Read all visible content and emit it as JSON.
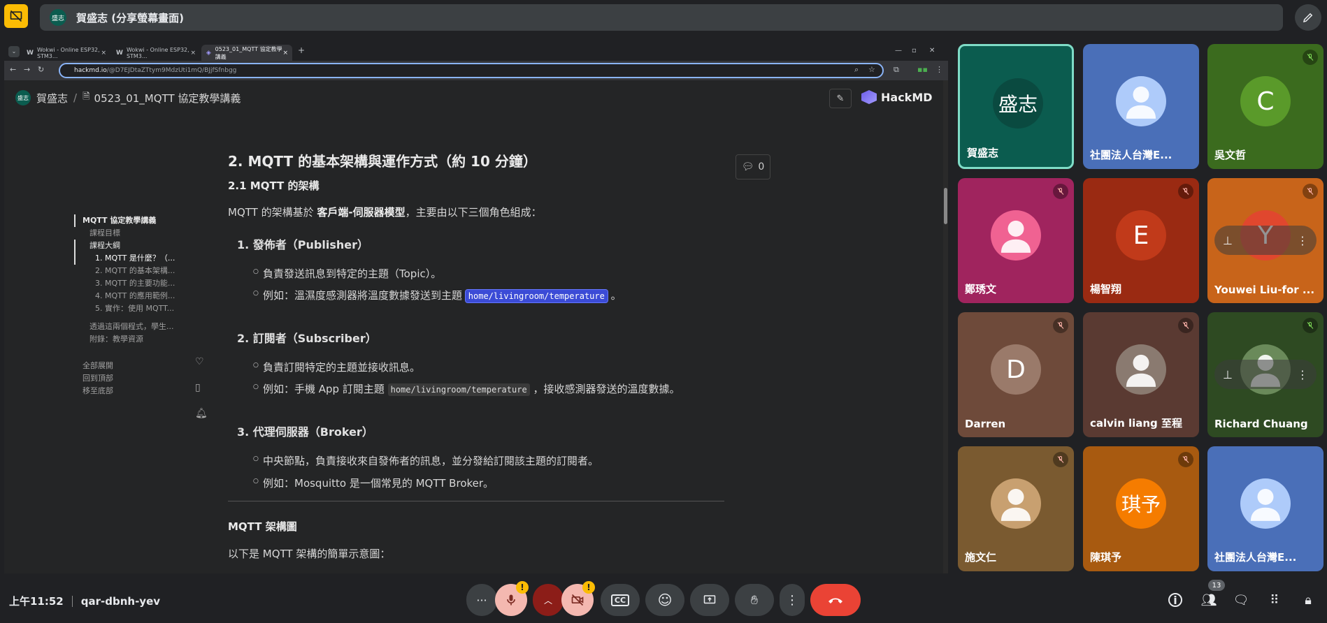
{
  "meeting": {
    "presenter_title": "賀盛志 (分享螢幕畫面)",
    "presenter_avatar": "盛志",
    "time": "上午11:52",
    "code": "qar-dbnh-yev",
    "participant_count": "13"
  },
  "browser": {
    "tabs": [
      {
        "label": "Wokwi - Online ESP32, STM3..."
      },
      {
        "label": "Wokwi - Online ESP32, STM3..."
      },
      {
        "label": "0523_01_MQTT 協定教學講義"
      }
    ],
    "url_host": "hackmd.io",
    "url_path": "/@D7EJDtaZTtym9MdzUti1mQ/BJjfSfnbgg"
  },
  "hackmd": {
    "author": "賀盛志",
    "author_avatar": "盛志",
    "doc_title": "0523_01_MQTT 協定教學講義",
    "brand": "HackMD",
    "comment_count": "0",
    "toc": {
      "root": "MQTT 協定教學講義",
      "items": [
        "課程目標",
        "課程大綱",
        "1. MQTT 是什麼？（...",
        "2. MQTT 的基本架構...",
        "3. MQTT 的主要功能...",
        "4. MQTT 的應用範例...",
        "5. 實作：使用 MQTT...",
        "透過這兩個程式，學生...",
        "附錄：教學資源"
      ],
      "controls": [
        "全部展開",
        "回到頂部",
        "移至底部"
      ]
    },
    "content": {
      "h2": "2. MQTT 的基本架構與運作方式（約 10 分鐘）",
      "h3": "2.1 MQTT 的架構",
      "intro_a": "MQTT 的架構基於 ",
      "intro_b": "客戶端-伺服器模型",
      "intro_c": "，主要由以下三個角色組成：",
      "role1": "1. 發佈者（Publisher）",
      "role1_a": "負責發送訊息到特定的主題（Topic）。",
      "role1_b_pre": "例如：溫濕度感測器將溫度數據發送到主題 ",
      "role1_code": "home/livingroom/temperature",
      "role1_b_post": " 。",
      "role2": "2. 訂閱者（Subscriber）",
      "role2_a": "負責訂閱特定的主題並接收訊息。",
      "role2_b_pre": "例如：手機 App 訂閱主題 ",
      "role2_code": "home/livingroom/temperature",
      "role2_b_post": " ，接收感測器發送的溫度數據。",
      "role3": "3. 代理伺服器（Broker）",
      "role3_a": "中央節點，負責接收來自發佈者的訊息，並分發給訂閱該主題的訂閱者。",
      "role3_b": "例如：Mosquitto 是一個常見的 MQTT Broker。",
      "h3b": "MQTT 架構圖",
      "p_last": "以下是 MQTT 架構的簡單示意圖："
    }
  },
  "participants": [
    {
      "name": "賀盛志",
      "initial": "盛志",
      "bg": "#0b5c4f",
      "circle": "#0a4a40",
      "muted": false,
      "speaking": true
    },
    {
      "name": "社團法人台灣E...",
      "initial": "",
      "bg": "#4a6fb8",
      "circle": "#aecbfa",
      "muted": false,
      "speaking": false
    },
    {
      "name": "吳文哲",
      "initial": "C",
      "bg": "#3b6b1e",
      "circle": "#5a9a2a",
      "muted": true,
      "speaking": false
    },
    {
      "name": "鄭琇文",
      "initial": "",
      "bg": "#a0245e",
      "circle": "#f06292",
      "muted": true,
      "speaking": false
    },
    {
      "name": "楊智翔",
      "initial": "E",
      "bg": "#9a2a12",
      "circle": "#c13a1a",
      "muted": true,
      "speaking": false
    },
    {
      "name": "Youwei Liu-for ...",
      "initial": "Y",
      "bg": "#c8641a",
      "circle": "#e0472e",
      "muted": true,
      "speaking": false
    },
    {
      "name": "Darren",
      "initial": "D",
      "bg": "#6e4a3a",
      "circle": "#9a7a6a",
      "muted": true,
      "speaking": false
    },
    {
      "name": "calvin liang 至程",
      "initial": "",
      "bg": "#5a3a32",
      "circle": "#8a7a70",
      "muted": true,
      "speaking": false
    },
    {
      "name": "Richard Chuang",
      "initial": "",
      "bg": "#2e4a22",
      "circle": "#6a8a5a",
      "muted": true,
      "speaking": false
    },
    {
      "name": "施文仁",
      "initial": "",
      "bg": "#7a5a30",
      "circle": "#c8a070",
      "muted": true,
      "speaking": false
    },
    {
      "name": "陳琪予",
      "initial": "琪予",
      "bg": "#a85a10",
      "circle": "#f57c00",
      "muted": true,
      "speaking": false
    },
    {
      "name": "社團法人台灣E...",
      "initial": "",
      "bg": "#4a6fb8",
      "circle": "#aecbfa",
      "muted": false,
      "speaking": false
    }
  ],
  "colors": {
    "accent": "#8ab4f8",
    "warn": "#fbbc04",
    "end_call": "#ea4335",
    "cam_off": "#f4b8b0"
  }
}
